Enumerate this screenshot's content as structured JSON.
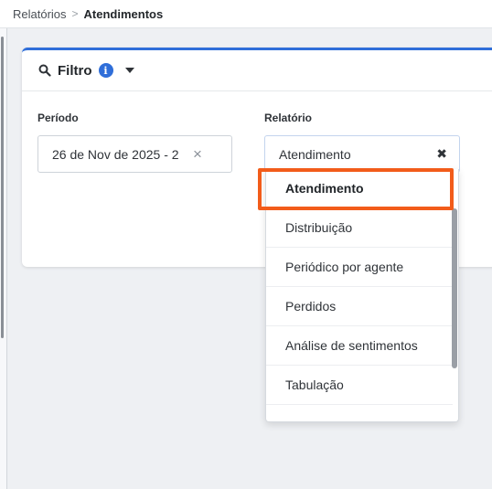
{
  "breadcrumb": {
    "parent": "Relatórios",
    "separator": ">",
    "current": "Atendimentos"
  },
  "filter": {
    "title": "Filtro",
    "info_icon": "i",
    "periodo": {
      "label": "Período",
      "value": "26 de Nov de 2025 - 2",
      "clear_icon": "×"
    },
    "relatorio": {
      "label": "Relatório",
      "value": "Atendimento",
      "remove_icon": "✖",
      "options": [
        "Atendimento",
        "Distribuição",
        "Periódico por agente",
        "Perdidos",
        "Análise de sentimentos",
        "Tabulação"
      ],
      "selected_index": 0
    }
  },
  "colors": {
    "accent": "#2f6ed9",
    "highlight": "#f25c1a"
  }
}
